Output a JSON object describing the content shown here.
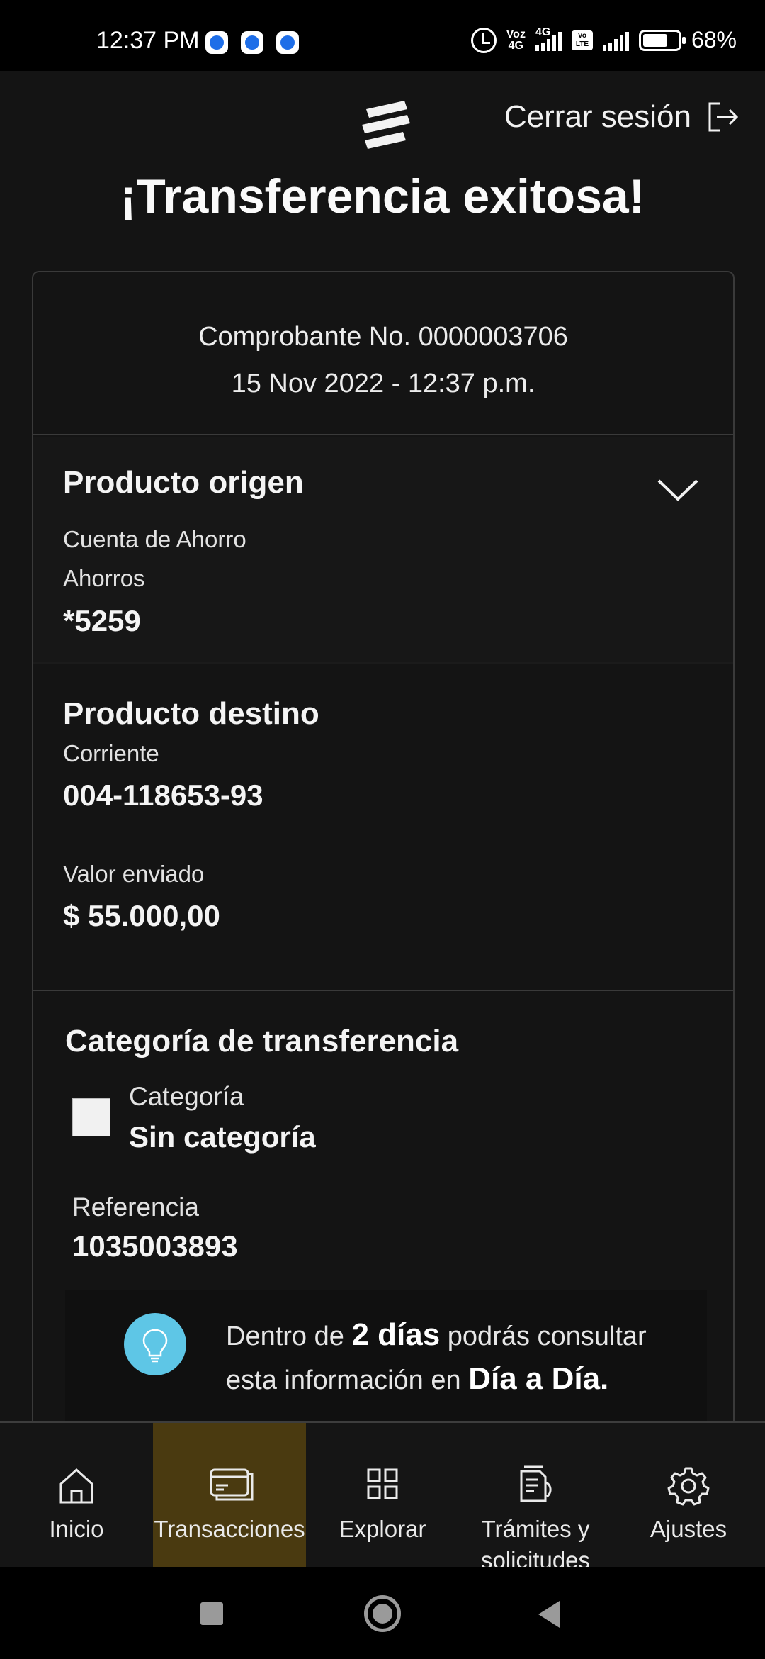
{
  "status_bar": {
    "time": "12:37 PM",
    "voz": "Voz",
    "net1": "4G",
    "net2": "4G",
    "lte_top": "Vo",
    "lte_bottom": "LTE",
    "battery": "68%"
  },
  "header": {
    "logout_label": "Cerrar sesión",
    "title": "¡Transferencia exitosa!"
  },
  "receipt": {
    "number": "Comprobante No. 0000003706",
    "date": "15 Nov 2022 - 12:37 p.m."
  },
  "origin": {
    "heading": "Producto origen",
    "account_type": "Cuenta de Ahorro",
    "account_subtype": "Ahorros",
    "account_number": "*5259"
  },
  "destination": {
    "heading": "Producto destino",
    "account_type": "Corriente",
    "account_number": "004-118653-93",
    "amount_label": "Valor enviado",
    "amount": "$ 55.000,00"
  },
  "category": {
    "heading": "Categoría de transferencia",
    "label": "Categoría",
    "value": "Sin categoría",
    "reference_label": "Referencia",
    "reference_value": "1035003893"
  },
  "tip": {
    "pre": "Dentro de ",
    "bold1": "2 días",
    "mid": " podrás consultar",
    "line2_pre": "esta información en ",
    "bold2": "Día a Día."
  },
  "nav": {
    "items": [
      {
        "label": "Inicio",
        "icon": "home-icon"
      },
      {
        "label": "Transacciones",
        "icon": "card-icon"
      },
      {
        "label": "Explorar",
        "icon": "grid-icon"
      },
      {
        "label": "Trámites y solicitudes",
        "icon": "document-icon"
      },
      {
        "label": "Ajustes",
        "icon": "gear-icon"
      }
    ],
    "active_index": 1
  },
  "colors": {
    "background": "#141414",
    "active_nav": "#4a3a10",
    "bulb": "#5ec6e6"
  }
}
